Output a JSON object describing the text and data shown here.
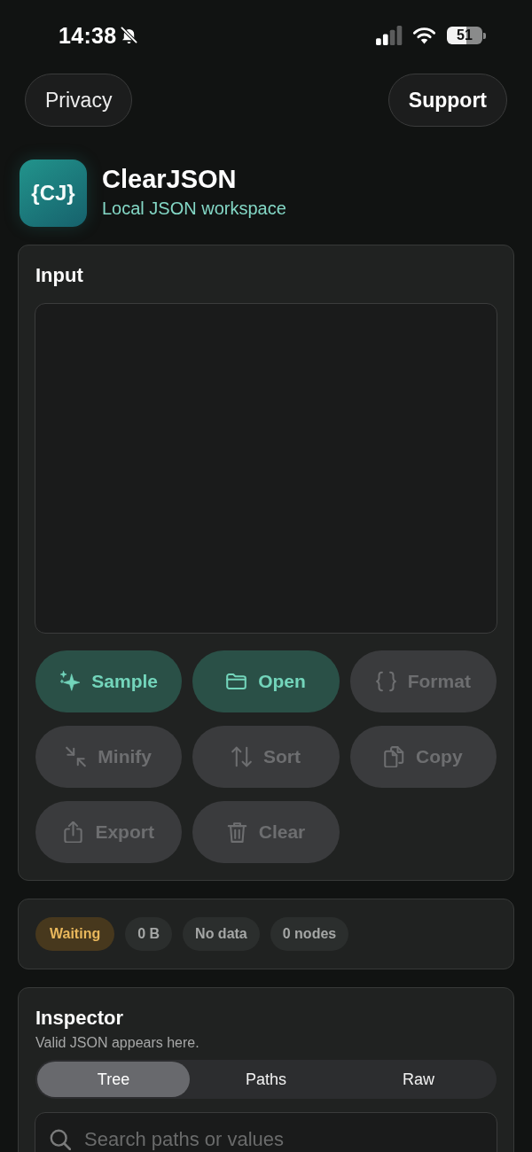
{
  "status_bar": {
    "time": "14:38",
    "silent": true,
    "battery": "51"
  },
  "header_buttons": [
    {
      "label": "Privacy",
      "emphasized": false
    },
    {
      "label": "Support",
      "emphasized": true
    }
  ],
  "app": {
    "logo": "{CJ}",
    "title": "ClearJSON",
    "subtitle": "Local JSON workspace"
  },
  "input": {
    "title": "Input",
    "actions": [
      {
        "label": "Sample",
        "disabled": false
      },
      {
        "label": "Open",
        "disabled": false
      },
      {
        "label": "Format",
        "disabled": true
      },
      {
        "label": "Minify",
        "disabled": true
      },
      {
        "label": "Sort",
        "disabled": true
      },
      {
        "label": "Copy",
        "disabled": true
      },
      {
        "label": "Export",
        "disabled": true
      },
      {
        "label": "Clear",
        "disabled": true
      }
    ]
  },
  "status": {
    "chips": [
      {
        "label": "Waiting",
        "kind": "warning"
      },
      {
        "label": "0 B",
        "kind": "neutral"
      },
      {
        "label": "No data",
        "kind": "neutral"
      },
      {
        "label": "0 nodes",
        "kind": "neutral"
      }
    ]
  },
  "inspector": {
    "title": "Inspector",
    "subtitle": "Valid JSON appears here.",
    "tabs": [
      {
        "label": "Tree",
        "selected": true
      },
      {
        "label": "Paths",
        "selected": false
      },
      {
        "label": "Raw",
        "selected": false
      }
    ],
    "search": {
      "placeholder": "Search paths or values"
    }
  }
}
